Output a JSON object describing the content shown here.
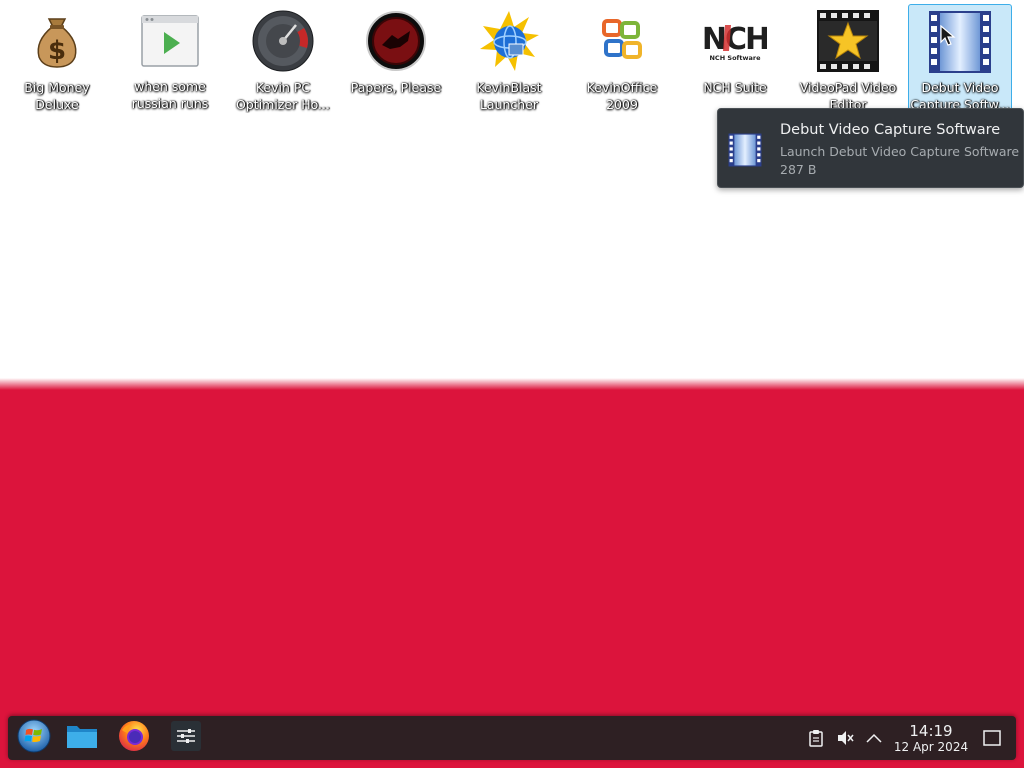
{
  "desktop": {
    "wallpaper_colors": {
      "top": "#ffffff",
      "bottom": "#dc143c"
    },
    "icons": [
      {
        "label": "Big Money Deluxe",
        "icon": "money-bag-icon"
      },
      {
        "label": "when some russian runs a...",
        "icon": "video-file-icon"
      },
      {
        "label": "Kevin PC Optimizer Ho...",
        "icon": "speedometer-icon"
      },
      {
        "label": "Papers, Please",
        "icon": "papers-please-emblem-icon"
      },
      {
        "label": "KevinBlast Launcher",
        "icon": "globe-burst-icon"
      },
      {
        "label": "KevinOffice 2009",
        "icon": "office-logo-icon"
      },
      {
        "label": "NCH Suite",
        "icon": "nch-logo-icon"
      },
      {
        "label": "VideoPad Video Editor",
        "icon": "film-star-icon"
      },
      {
        "label": "Debut Video Capture Softw...",
        "icon": "film-strip-icon",
        "selected": true
      }
    ]
  },
  "tooltip": {
    "title": "Debut Video Capture Software",
    "subtitle": "Launch Debut Video Capture Software",
    "size": "287 B",
    "icon": "film-strip-icon"
  },
  "taskbar": {
    "launchers": [
      {
        "name": "start-menu",
        "icon": "windows-orb-icon"
      },
      {
        "name": "file-manager",
        "icon": "folder-icon"
      },
      {
        "name": "firefox",
        "icon": "firefox-icon"
      },
      {
        "name": "settings",
        "icon": "sliders-icon"
      }
    ],
    "tray": {
      "icons": [
        "clipboard-icon",
        "volume-muted-icon",
        "chevron-up-icon"
      ],
      "time": "14:19",
      "date": "12 Apr 2024"
    },
    "accent": "#2e2023"
  }
}
